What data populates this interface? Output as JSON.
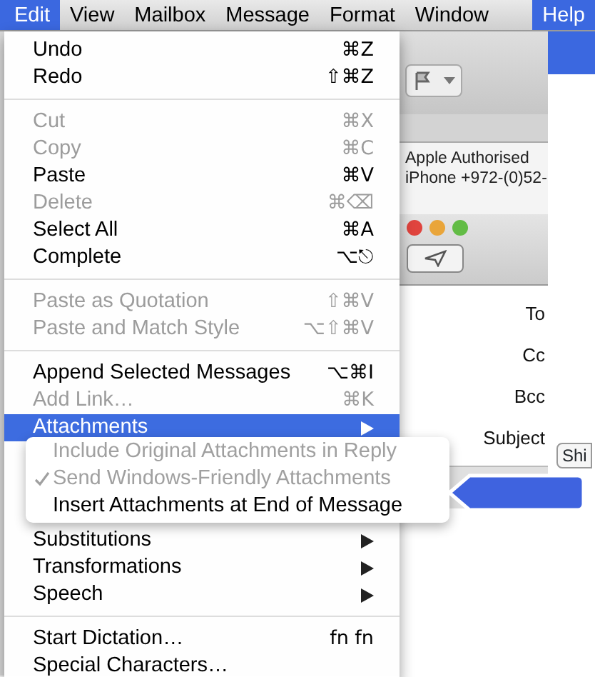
{
  "menu_bar": [
    {
      "label": "Edit",
      "selected": true
    },
    {
      "label": "View",
      "selected": false
    },
    {
      "label": "Mailbox",
      "selected": false
    },
    {
      "label": "Message",
      "selected": false
    },
    {
      "label": "Format",
      "selected": false
    },
    {
      "label": "Window",
      "selected": false
    },
    {
      "label": "Help",
      "selected": true
    }
  ],
  "edit_menu": [
    {
      "kind": "item",
      "label": "Undo",
      "shortcut": "⌘Z",
      "disabled": false,
      "selected": false
    },
    {
      "kind": "item",
      "label": "Redo",
      "shortcut": "⇧⌘Z",
      "disabled": false,
      "selected": false
    },
    {
      "kind": "separator"
    },
    {
      "kind": "item",
      "label": "Cut",
      "shortcut": "⌘X",
      "disabled": true,
      "selected": false
    },
    {
      "kind": "item",
      "label": "Copy",
      "shortcut": "⌘C",
      "disabled": true,
      "selected": false
    },
    {
      "kind": "item",
      "label": "Paste",
      "shortcut": "⌘V",
      "disabled": false,
      "selected": false
    },
    {
      "kind": "item",
      "label": "Delete",
      "shortcut": "⌘⌫",
      "disabled": true,
      "selected": false
    },
    {
      "kind": "item",
      "label": "Select All",
      "shortcut": "⌘A",
      "disabled": false,
      "selected": false
    },
    {
      "kind": "item",
      "label": "Complete",
      "shortcut": "⌥⎋",
      "disabled": false,
      "selected": false
    },
    {
      "kind": "separator"
    },
    {
      "kind": "item",
      "label": "Paste as Quotation",
      "shortcut": "⇧⌘V",
      "disabled": true,
      "selected": false
    },
    {
      "kind": "item",
      "label": "Paste and Match Style",
      "shortcut": "⌥⇧⌘V",
      "disabled": true,
      "selected": false
    },
    {
      "kind": "separator"
    },
    {
      "kind": "item",
      "label": "Append Selected Messages",
      "shortcut": "⌥⌘I",
      "disabled": false,
      "selected": false
    },
    {
      "kind": "item",
      "label": "Add Link…",
      "shortcut": "⌘K",
      "disabled": true,
      "selected": false
    },
    {
      "kind": "submenu",
      "label": "Attachments",
      "disabled": false,
      "selected": true
    },
    {
      "kind": "submenu",
      "label": "Substitutions",
      "disabled": false,
      "selected": false
    },
    {
      "kind": "submenu",
      "label": "Transformations",
      "disabled": false,
      "selected": false
    },
    {
      "kind": "submenu",
      "label": "Speech",
      "disabled": false,
      "selected": false
    },
    {
      "kind": "separator"
    },
    {
      "kind": "item",
      "label": "Start Dictation…",
      "shortcut": "fn fn",
      "disabled": false,
      "selected": false
    },
    {
      "kind": "item",
      "label": "Special Characters…",
      "disabled": false,
      "selected": false
    }
  ],
  "attachments_submenu": [
    {
      "label": "Include Original Attachments in Reply",
      "checked": false,
      "disabled": true
    },
    {
      "label": "Send Windows-Friendly Attachments",
      "checked": true,
      "disabled": true
    },
    {
      "label": "Insert Attachments at End of Message",
      "checked": false,
      "disabled": false
    }
  ],
  "background": {
    "sender_lines": [
      "Apple Authorised",
      "iPhone +972-(0)52-"
    ],
    "header_labels": [
      "To",
      "Cc",
      "Bcc",
      "Subject"
    ],
    "field_text": "Shi"
  }
}
